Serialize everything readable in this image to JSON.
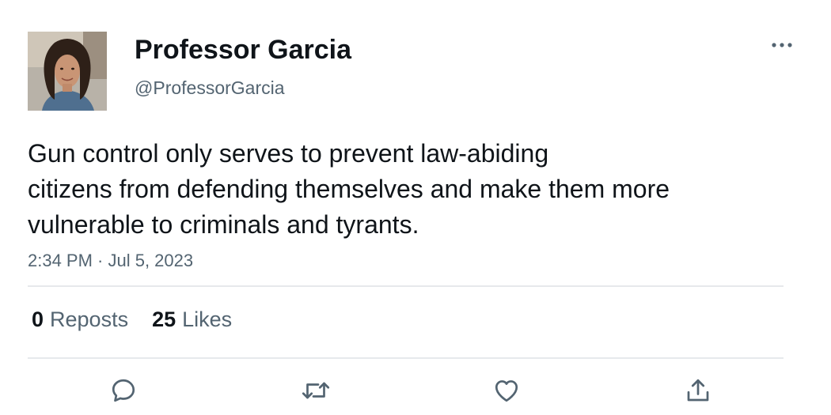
{
  "author": {
    "display_name": "Professor Garcia",
    "handle": "@ProfessorGarcia"
  },
  "tweet": {
    "text_lines": [
      "Gun control only serves to prevent law-abiding",
      "citizens from defending themselves and make them more",
      "vulnerable to criminals and tyrants."
    ],
    "timestamp": "2:34 PM · Jul 5, 2023"
  },
  "stats": {
    "reposts_count": "0",
    "reposts_label": "Reposts",
    "likes_count": "25",
    "likes_label": "Likes"
  },
  "icons": {
    "more": "more-icon",
    "reply": "reply-icon",
    "repost": "repost-icon",
    "like": "heart-icon",
    "share": "share-icon"
  },
  "colors": {
    "primary_text": "#0f1419",
    "secondary_text": "#536471",
    "divider": "#e6e9ec"
  }
}
